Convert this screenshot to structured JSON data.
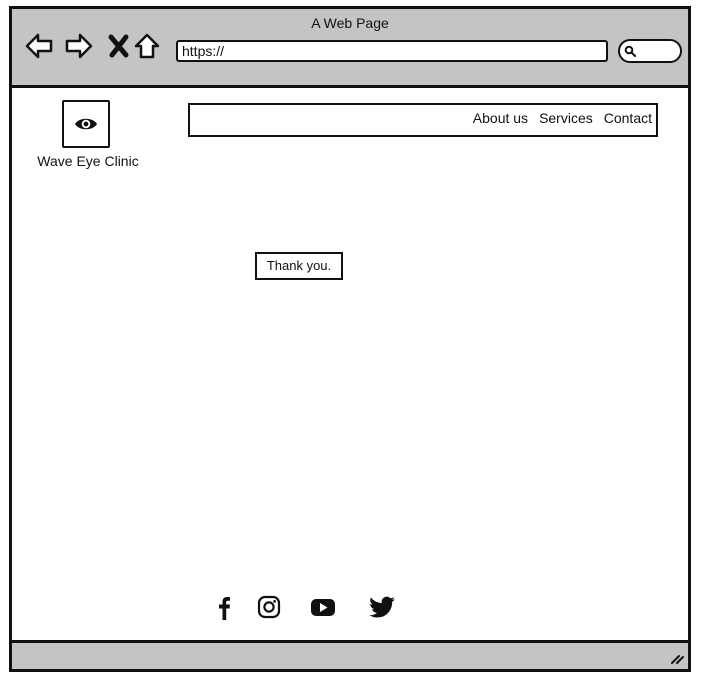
{
  "window": {
    "title": "A Web Page"
  },
  "browser": {
    "address": "https://",
    "icons": [
      "back-arrow-icon",
      "forward-arrow-icon",
      "close-icon",
      "home-icon",
      "search-icon"
    ]
  },
  "site": {
    "logo_icon": "eye-icon",
    "name": "Wave Eye Clinic",
    "nav": [
      "About us",
      "Services",
      "Contact"
    ]
  },
  "main": {
    "message": "Thank you."
  },
  "footer": {
    "social_icons": [
      "facebook-icon",
      "instagram-icon",
      "youtube-icon",
      "twitter-icon"
    ]
  },
  "colors": {
    "chrome_gray": "#c4c4c4",
    "stroke": "#111111",
    "page_bg": "#ffffff"
  }
}
